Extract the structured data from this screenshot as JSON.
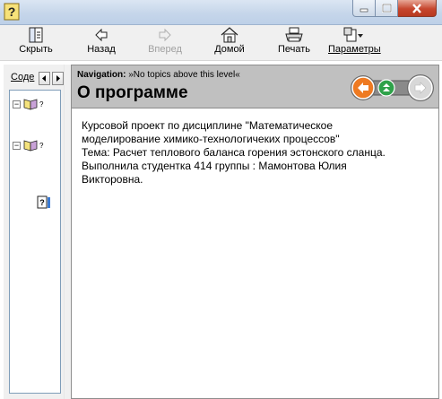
{
  "window": {
    "icon": "help-question-icon",
    "minimize": "minimize-icon",
    "maximize": "maximize-icon",
    "close": "close-icon"
  },
  "toolbar": {
    "hide_label": "Скрыть",
    "back_label": "Назад",
    "forward_label": "Вперед",
    "home_label": "Домой",
    "print_label": "Печать",
    "options_label": "Параметры"
  },
  "sidebar": {
    "tab_label": "Соде",
    "tree": [
      {
        "expanded": true,
        "icon": "book-icon",
        "label": "?"
      },
      {
        "expanded": true,
        "icon": "book-icon",
        "label": "?"
      },
      {
        "expanded": false,
        "icon": "help-topic-icon",
        "label": ""
      }
    ]
  },
  "content": {
    "nav_prefix": "Navigation:",
    "nav_text": "»No topics above this level«",
    "title": "О программе",
    "body_lines": [
      "Курсовой проект  по дисциплине \"Математическое",
      "моделирование химико-технологичеких процессов\"",
      "Тема: Расчет теплового баланса  горения эстонского сланца.",
      "Выполнила студентка 414 группы : Мамонтова Юлия",
      "Викторовна."
    ]
  },
  "colors": {
    "header_band": "#c0c0c0",
    "nav_back": "#e86a1c",
    "nav_up": "#2fa24a",
    "nav_next": "#d8d8d8"
  }
}
